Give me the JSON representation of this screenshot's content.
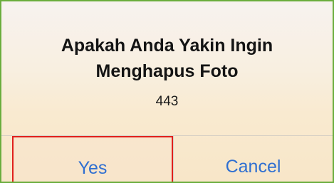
{
  "dialog": {
    "title_line1": "Apakah Anda Yakin Ingin",
    "title_line2": "Menghapus Foto",
    "message": "443",
    "buttons": {
      "yes_label": "Yes",
      "cancel_label": "Cancel"
    }
  },
  "colors": {
    "frame_border": "#6aad3d",
    "button_text": "#2f6fd1",
    "highlight_border": "#e0201c"
  }
}
